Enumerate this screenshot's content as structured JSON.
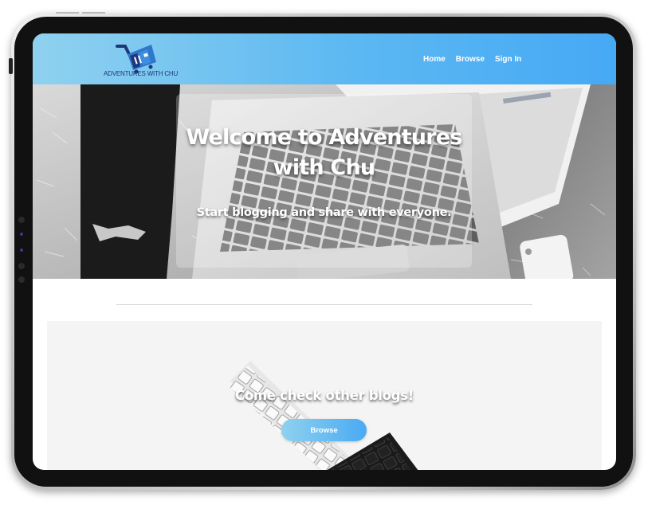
{
  "brand": {
    "logo_text": "ADVENTURES WITH CHU",
    "logo_icon": "shopping-cart-logo-icon",
    "color_dark": "#20367a",
    "color_accent": "#2f77c9"
  },
  "nav": {
    "links": [
      {
        "label": "Home"
      },
      {
        "label": "Browse"
      },
      {
        "label": "Sign In"
      }
    ],
    "gradient": [
      "#8fd1ef",
      "#46a9f4"
    ]
  },
  "hero": {
    "title": "Welcome to Adventures with Chu",
    "subtitle": "Start blogging and share with everyone.",
    "background": "laptop-on-fur-rug-photo"
  },
  "section": {
    "title": "Come check other blogs!",
    "button_label": "Browse",
    "background": "keyboards-photo"
  }
}
